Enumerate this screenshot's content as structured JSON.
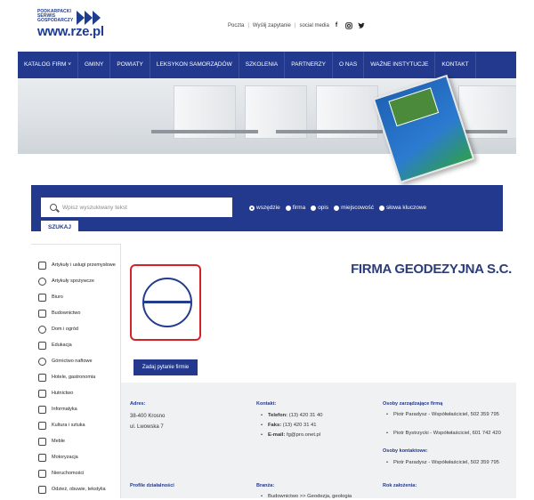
{
  "brand": {
    "logo_lines": [
      "PODKARPACKI",
      "SERWIS",
      "GOSPODARCZY"
    ],
    "logo_url": "www.rze.pl"
  },
  "toplinks": [
    "Poczta",
    "Wyślij zapytanie",
    "social media"
  ],
  "social_icons": [
    "facebook-icon",
    "instagram-icon",
    "twitter-icon"
  ],
  "nav": {
    "items": [
      "KATALOG FIRM",
      "GMINY",
      "POWIATY",
      "LEKSYKON SAMORZĄDÓW",
      "SZKOLENIA",
      "PARTNERZY",
      "O NAS",
      "WAŻNE INSTYTUCJE",
      "KONTAKT"
    ]
  },
  "search": {
    "placeholder": "Wpisz wyszukiwany tekst",
    "options": [
      "wszędzie",
      "firma",
      "opis",
      "miejscowość",
      "słowa kluczowe"
    ],
    "selected": "wszędzie",
    "button": "SZUKAJ"
  },
  "sidebar": {
    "items": [
      "Artykuły i usługi przemysłowe",
      "Artykuły spożywcze",
      "Biuro",
      "Budownictwo",
      "Dom i ogród",
      "Edukacja",
      "Górnictwo naftowe",
      "Hotele, gastronomia",
      "Hutnictwo",
      "Informatyka",
      "Kultura i sztuka",
      "Meble",
      "Motoryzacja",
      "Nieruchomości",
      "Odzież, obuwie, tekstylia"
    ]
  },
  "company": {
    "title": "FIRMA GEODEZYJNA S.C.",
    "ask_button": "Zadaj pytanie firmie",
    "address_label": "Adres:",
    "address_lines": [
      "38-400 Krosno",
      "ul. Lwowska 7"
    ],
    "contact_label": "Kontakt:",
    "contact": [
      {
        "label": "Telefon:",
        "value": "(13) 420 31 40"
      },
      {
        "label": "Faks:",
        "value": "(13) 420 31 41"
      },
      {
        "label": "E-mail:",
        "value": "fg@pro.onet.pl"
      }
    ],
    "management_label": "Osoby zarządzające firmą",
    "management": [
      "Piotr Paradysz - Współwłaściciel, 502 359 795",
      "Piotr Bystrzycki - Współwłaściciel, 601 742 420"
    ],
    "contact_persons_label": "Osoby kontaktowe:",
    "contact_persons": [
      "Piotr Paradysz - Współwłaściciel, 502 359 795"
    ],
    "profile_label": "Profile działalności",
    "branch_label": "Branża:",
    "branch_value": "Budownictwo >> Geodezja, geologia",
    "founded_label": "Rok założenia:"
  }
}
